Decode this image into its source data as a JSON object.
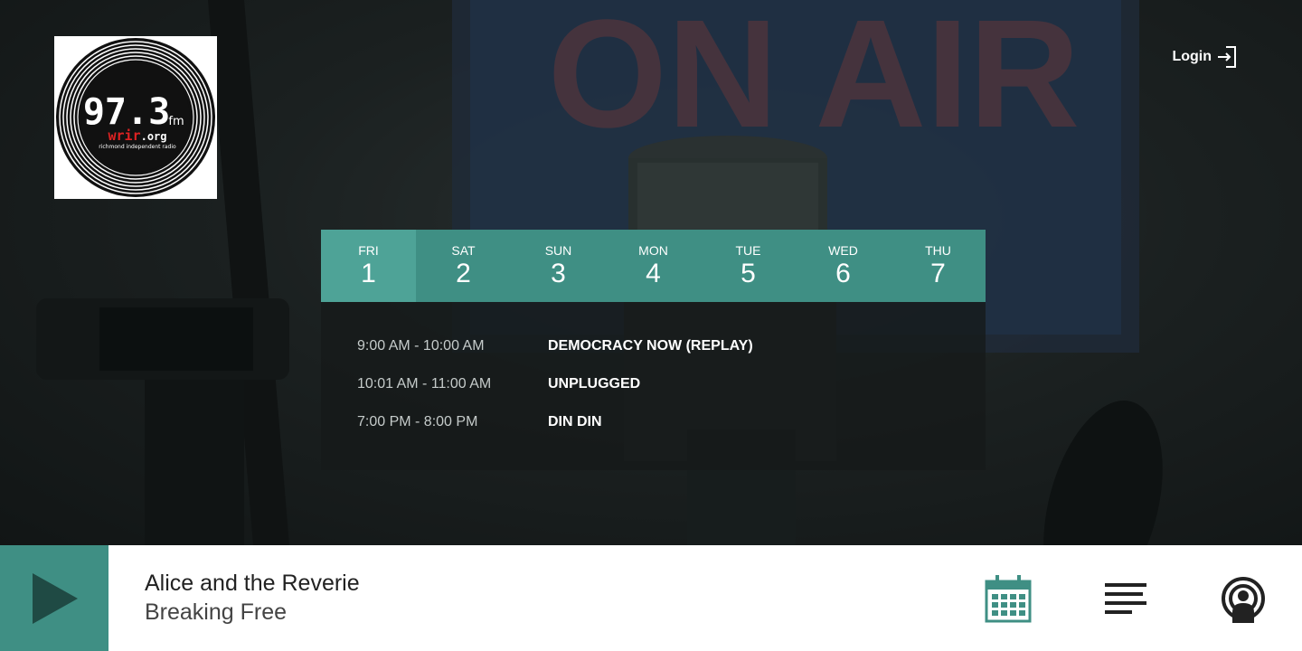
{
  "logo": {
    "frequency": "97.3",
    "band": "fm",
    "call_sign": "wrir",
    "domain_suffix": ".org",
    "tagline": "richmond independent radio"
  },
  "background_sign": "ON AIR",
  "login": {
    "label": "Login",
    "icon": "login-arrow-icon"
  },
  "schedule": {
    "days": [
      {
        "name": "FRI",
        "num": "1",
        "active": true
      },
      {
        "name": "SAT",
        "num": "2"
      },
      {
        "name": "SUN",
        "num": "3"
      },
      {
        "name": "MON",
        "num": "4"
      },
      {
        "name": "TUE",
        "num": "5"
      },
      {
        "name": "WED",
        "num": "6"
      },
      {
        "name": "THU",
        "num": "7"
      }
    ],
    "shows": [
      {
        "time": "9:00 AM - 10:00 AM",
        "title": "DEMOCRACY NOW (REPLAY)"
      },
      {
        "time": "10:01 AM - 11:00 AM",
        "title": "UNPLUGGED"
      },
      {
        "time": "7:00 PM - 8:00 PM",
        "title": "DIN DIN"
      }
    ]
  },
  "player": {
    "artist": "Alice and the Reverie",
    "track": "Breaking Free",
    "play_icon": "play-icon",
    "icons": [
      "calendar-icon",
      "playlist-icon",
      "podcast-icon"
    ]
  },
  "colors": {
    "accent": "#3f8f84",
    "accent_active": "#4ea397",
    "play_triangle": "#1f4a44",
    "icon_dark": "#222222"
  }
}
